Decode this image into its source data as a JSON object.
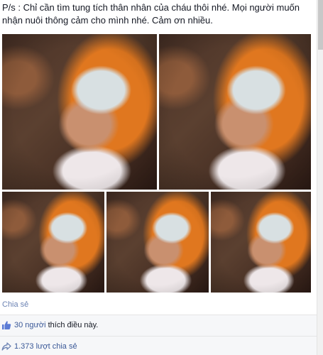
{
  "post": {
    "text_line1": "P/s : Chỉ cần tìm tung tích thân nhân của cháu thôi nhé. Mọi người muốn",
    "text_line2": "nhận nuôi thông cảm cho mình nhé. Cảm ơn nhiều."
  },
  "photos": [
    {
      "label": "baby-photo-1"
    },
    {
      "label": "baby-photo-2"
    },
    {
      "label": "baby-photo-3"
    },
    {
      "label": "baby-photo-4"
    },
    {
      "label": "baby-photo-5"
    }
  ],
  "actions": {
    "share_label": "Chia sẻ"
  },
  "stats": {
    "likes_link": "30 người",
    "likes_suffix": " thích điều này.",
    "shares_link": "1.373 lượt chia sẻ"
  },
  "icons": {
    "like": "thumbs-up-icon",
    "share": "share-arrow-icon"
  },
  "colors": {
    "link": "#3b5998",
    "muted_link": "#6d84b4",
    "stats_bg": "#f6f7f9"
  }
}
